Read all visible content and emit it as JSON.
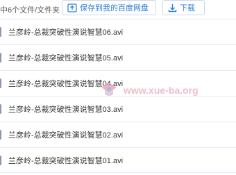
{
  "toolbar": {
    "file_count": "中6个文件/文件夹",
    "save_label": "保存到我的百度网盘",
    "download_label": "下载",
    "accent": "#2f7fd6"
  },
  "files": [
    {
      "name": "兰彦岭-总裁突破性演说智慧06.avi"
    },
    {
      "name": "兰彦岭-总裁突破性演说智慧05.avi"
    },
    {
      "name": "兰彦岭-总裁突破性演说智慧04.avi"
    },
    {
      "name": "兰彦岭-总裁突破性演说智慧03.avi"
    },
    {
      "name": "兰彦岭-总裁突破性演说智慧02.avi"
    },
    {
      "name": "兰彦岭-总裁突破性演说智慧01.avi"
    }
  ],
  "watermark": {
    "text": "www.xue-ba.org",
    "icon": "xueba-logo"
  }
}
